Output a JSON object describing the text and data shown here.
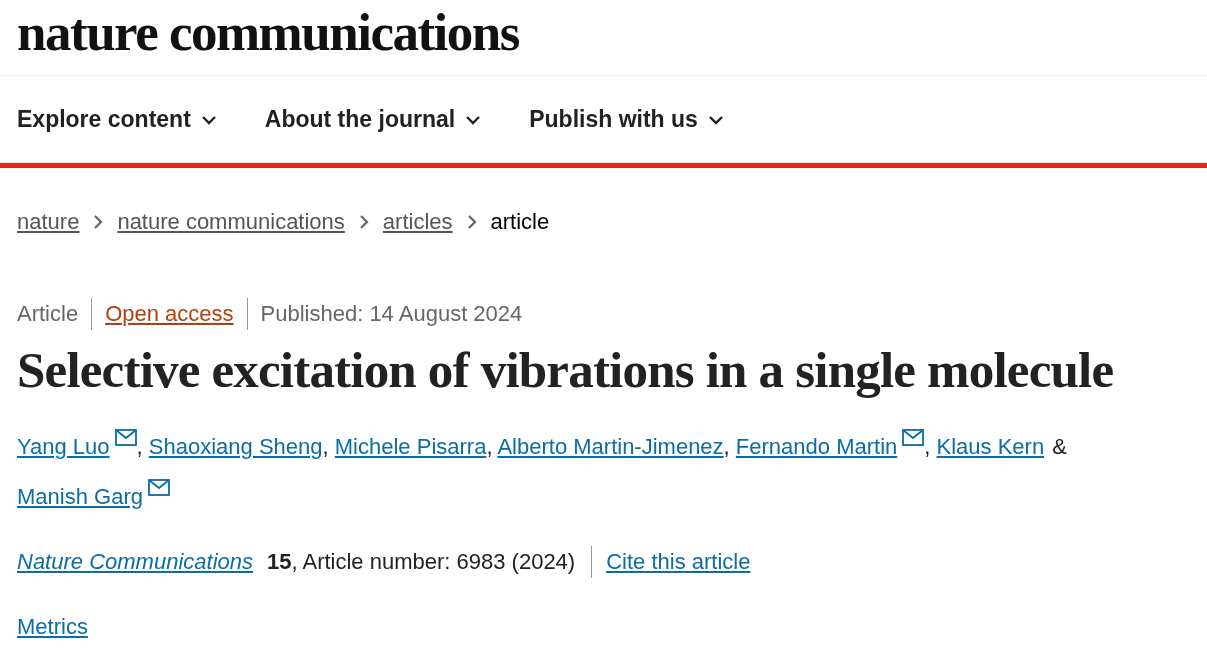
{
  "logo": "nature communications",
  "nav": [
    {
      "label": "Explore content",
      "expanded": false
    },
    {
      "label": "About the journal",
      "expanded": false
    },
    {
      "label": "Publish with us",
      "expanded": false
    }
  ],
  "breadcrumbs": [
    {
      "label": "nature",
      "current": false
    },
    {
      "label": "nature communications",
      "current": false
    },
    {
      "label": "articles",
      "current": false
    },
    {
      "label": "article",
      "current": true
    }
  ],
  "meta": {
    "type": "Article",
    "access": "Open access",
    "published": "Published: 14 August 2024"
  },
  "title": "Selective excitation of vibrations in a single molecule",
  "authors": [
    {
      "name": "Yang Luo",
      "corresponding": true,
      "separator": ","
    },
    {
      "name": "Shaoxiang Sheng",
      "corresponding": false,
      "separator": ","
    },
    {
      "name": "Michele Pisarra",
      "corresponding": false,
      "separator": ","
    },
    {
      "name": "Alberto Martin-Jimenez",
      "corresponding": false,
      "separator": ","
    },
    {
      "name": "Fernando Martin",
      "corresponding": true,
      "separator": ","
    },
    {
      "name": "Klaus Kern",
      "corresponding": false,
      "separator": "&"
    },
    {
      "name": "Manish Garg",
      "corresponding": true
    }
  ],
  "citation": {
    "journal": "Nature Communications",
    "details": "**15**, Article number: 6983 (2024)",
    "cite_link": "Cite this article"
  },
  "metrics_link": "Metrics"
}
